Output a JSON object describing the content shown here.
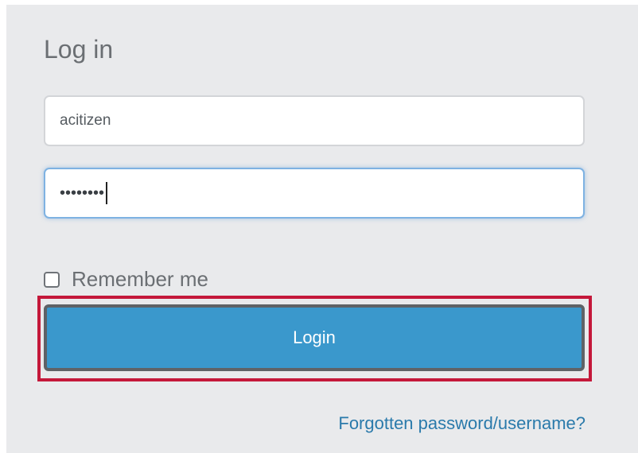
{
  "form": {
    "title": "Log in",
    "username_value": "acitizen",
    "password_mask": "••••••••",
    "remember_label": "Remember me",
    "remember_checked": false,
    "login_label": "Login",
    "forgot_link": "Forgotten password/username?"
  },
  "colors": {
    "button": "#3a98cc",
    "highlight": "#c4183a",
    "link": "#2a7aab"
  }
}
